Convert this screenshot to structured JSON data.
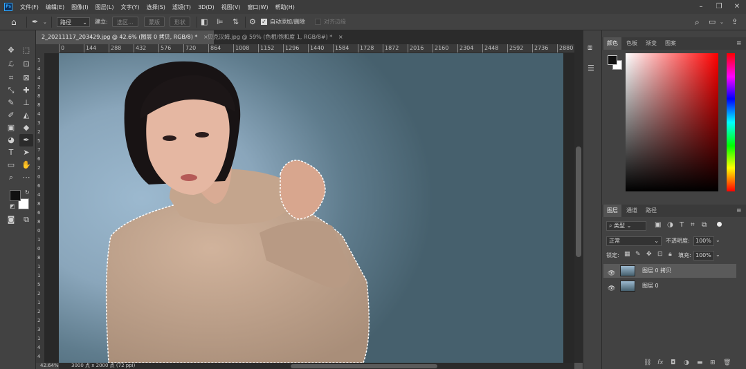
{
  "app": {
    "logo": "Ps"
  },
  "menu": [
    "文件(F)",
    "编辑(E)",
    "图像(I)",
    "图层(L)",
    "文字(Y)",
    "选择(S)",
    "滤镜(T)",
    "3D(D)",
    "视图(V)",
    "窗口(W)",
    "帮助(H)"
  ],
  "options": {
    "mode": "路径",
    "build_label": "建立:",
    "selection_btn": "选区...",
    "mask_btn": "蒙版",
    "shape_btn": "形状",
    "auto_add_delete": "自动添加/删除",
    "align_edges": "对齐边缘"
  },
  "tabs": [
    {
      "label": "2_20211117_203429.jpg @ 42.6% (图层 0 拷贝, RGB/8) *",
      "close": "×"
    },
    {
      "label": "贝克汉姆.jpg @ 59% (色相/饱和度 1, RGB/8#) *",
      "close": "×"
    }
  ],
  "ruler": {
    "h_ticks": [
      "0",
      "144",
      "288",
      "432",
      "576",
      "720",
      "864",
      "1008",
      "1152",
      "1296",
      "1440",
      "1584",
      "1728",
      "1872",
      "2016",
      "2160",
      "2304",
      "2448",
      "2592",
      "2736",
      "2880",
      "30"
    ],
    "v_ticks": [
      "1",
      "4",
      "4",
      "2",
      "8",
      "8",
      "4",
      "3",
      "2",
      "5",
      "7",
      "6",
      "2",
      "0",
      "6",
      "4",
      "8",
      "6",
      "8",
      "0",
      "1",
      "0",
      "8",
      "1",
      "1",
      "5",
      "2",
      "1",
      "2",
      "2",
      "3",
      "1",
      "4",
      "4"
    ]
  },
  "status": {
    "zoom": "42.64%",
    "doc_info": "3000 点 x 2000 点 (72 ppi)"
  },
  "color_panel": {
    "tabs": [
      "颜色",
      "色板",
      "渐变",
      "图案"
    ],
    "foreground": "#111111",
    "background": "#ffffff"
  },
  "layers_panel": {
    "tabs": [
      "图层",
      "通道",
      "路径"
    ],
    "filter": "类型",
    "blend_mode": "正常",
    "opacity_label": "不透明度:",
    "opacity": "100%",
    "lock_label": "锁定:",
    "fill_label": "填充:",
    "fill": "100%",
    "layers": [
      {
        "name": "图层 0 拷贝",
        "visible": true,
        "selected": true
      },
      {
        "name": "图层 0",
        "visible": true,
        "selected": false
      }
    ],
    "bottom_icons": [
      "link-icon",
      "fx-icon",
      "mask-icon",
      "adjustment-icon",
      "folder-icon",
      "new-layer-icon",
      "trash-icon"
    ]
  },
  "colors": {
    "accent": "#31a8ff",
    "panel": "#424242",
    "dark": "#2b2b2b"
  }
}
